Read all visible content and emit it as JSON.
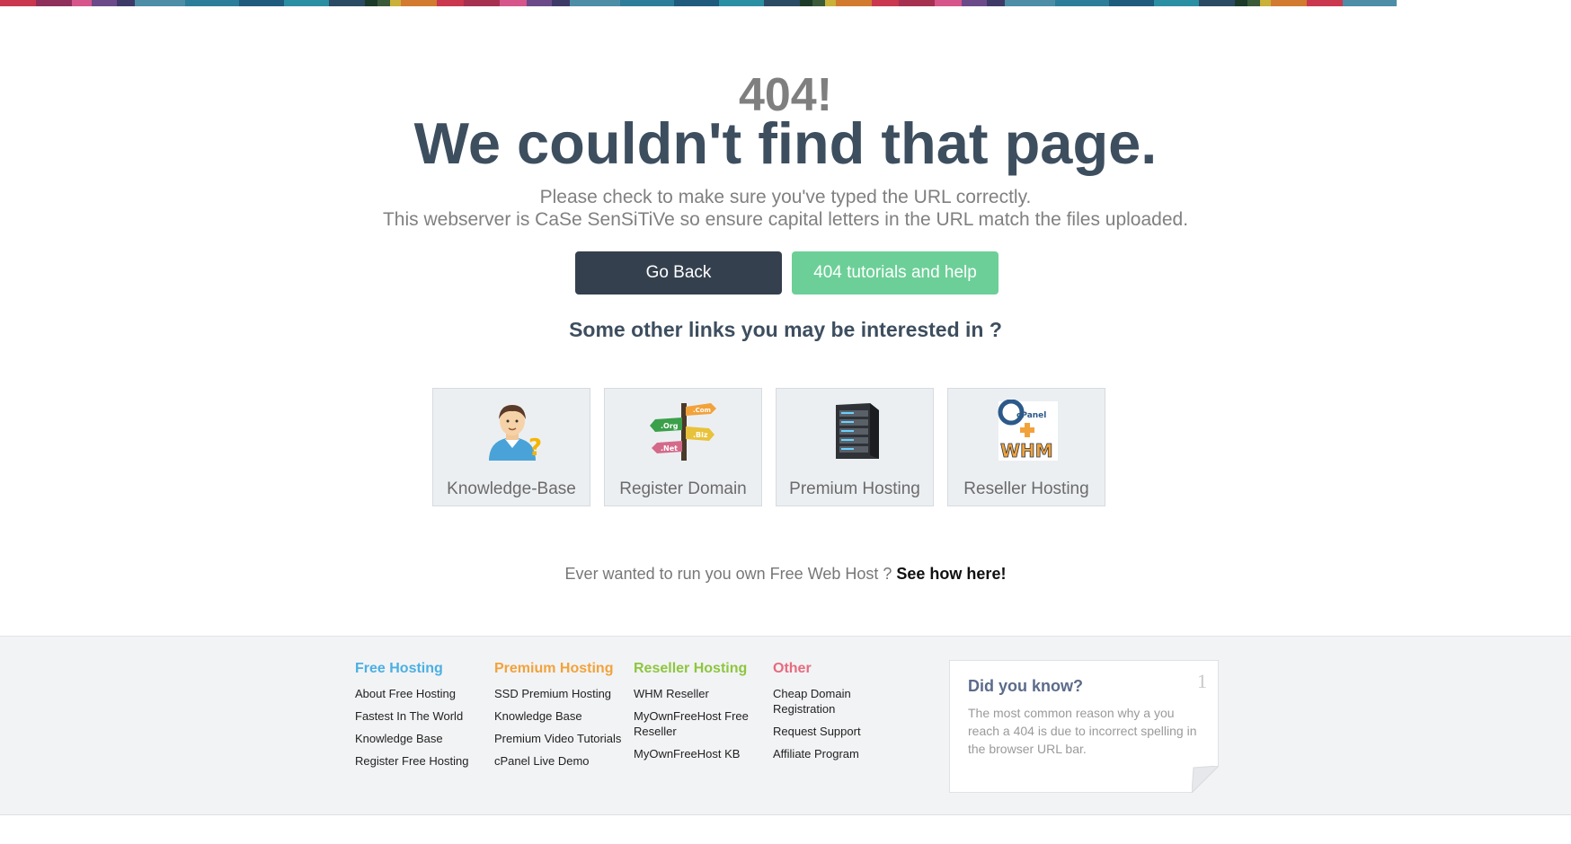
{
  "stripe_colors": [
    "#c9384f",
    "#8e2f5c",
    "#d6558a",
    "#6b4a8a",
    "#3e3a68",
    "#3d8aa8",
    "#2c7d99",
    "#1e5b7c",
    "#2b8fa3",
    "#2b4a63",
    "#1c3a4a",
    "#3a5a3a",
    "#c9b13a",
    "#d27a2f",
    "#c9384f",
    "#a63050",
    "#5c2e5a",
    "#3d8aa8",
    "#4fa1b5",
    "#7aa0b8"
  ],
  "hero": {
    "code": "404!",
    "headline": "We couldn't find that page.",
    "message_1": "Please check to make sure you've typed the URL correctly.",
    "message_2": "This webserver is CaSe SenSiTiVe so ensure capital letters in the URL match the files uploaded."
  },
  "buttons": {
    "back": "Go Back",
    "help": "404 tutorials and help"
  },
  "other_links_heading": "Some other links you may be interested in ?",
  "tiles": [
    {
      "label": "Knowledge-Base",
      "icon": "knowledge-base-icon"
    },
    {
      "label": "Register Domain",
      "icon": "domain-signpost-icon"
    },
    {
      "label": "Premium Hosting",
      "icon": "server-icon"
    },
    {
      "label": "Reseller Hosting",
      "icon": "cpanel-whm-icon"
    }
  ],
  "promo": {
    "text": "Ever wanted to run you own Free Web Host ? ",
    "link": "See how here!"
  },
  "footer": {
    "columns": [
      {
        "title": "Free Hosting",
        "links": [
          "About Free Hosting",
          "Fastest In The World",
          "Knowledge Base",
          "Register Free Hosting"
        ]
      },
      {
        "title": "Premium Hosting",
        "links": [
          "SSD Premium Hosting",
          "Knowledge Base",
          "Premium Video Tutorials",
          "cPanel Live Demo"
        ]
      },
      {
        "title": "Reseller Hosting",
        "links": [
          "WHM Reseller",
          "MyOwnFreeHost Free Reseller",
          "MyOwnFreeHost KB"
        ]
      },
      {
        "title": "Other",
        "links": [
          "Cheap Domain Registration",
          "Request Support",
          "Affiliate Program"
        ]
      }
    ],
    "did_you_know": {
      "title": "Did you know?",
      "number": "1",
      "text": "The most common reason why a you reach a 404 is due to incorrect spelling in the browser URL bar."
    }
  }
}
